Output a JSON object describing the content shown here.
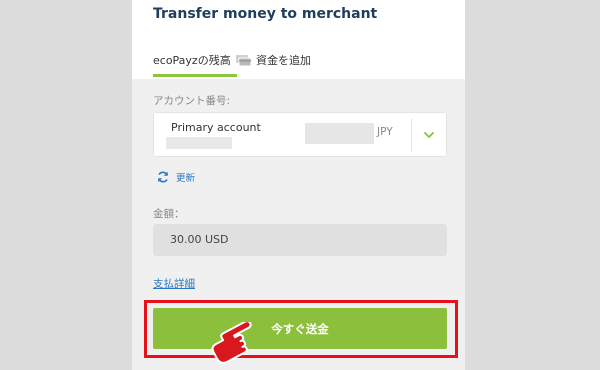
{
  "header": {
    "title": "Transfer money to merchant"
  },
  "tabs": [
    {
      "label": "ecoPayzの残高"
    },
    {
      "label": "資金を追加"
    }
  ],
  "account": {
    "label": "アカウント番号:",
    "selected_name": "Primary account",
    "currency": "JPY"
  },
  "refresh": {
    "label": "更新"
  },
  "amount": {
    "label": "金額：",
    "value": "30.00 USD"
  },
  "payment_details": {
    "label": "支払詳細"
  },
  "send_button": {
    "label": "今すぐ送金"
  },
  "colors": {
    "accent_green": "#8bbf3c",
    "title_navy": "#1f3d5c",
    "link_blue": "#2a78c2",
    "highlight_red": "#e8101b",
    "pointer_red": "#d7191f"
  },
  "icons": {
    "add_funds": "cards-icon",
    "dropdown": "chevron-down-icon",
    "refresh": "refresh-icon",
    "pointer": "pointing-hand-icon"
  }
}
